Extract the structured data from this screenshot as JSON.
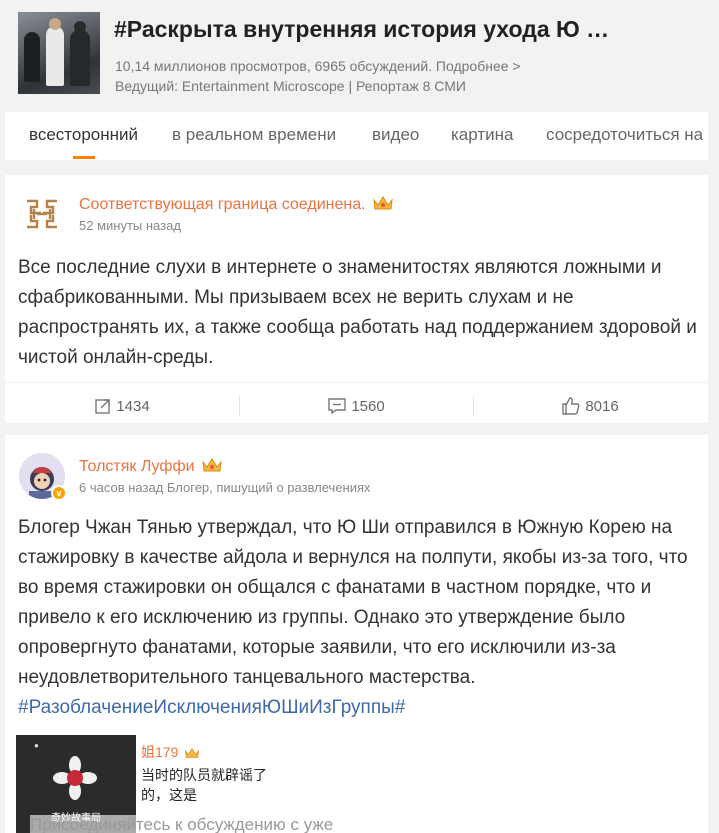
{
  "topic": {
    "title": "#Раскрыта внутренняя история ухода Ю …",
    "meta": "10,14 миллионов просмотров, 6965 обсуждений. Подробнее >",
    "host": "Ведущий: Entertainment Microscope | Репортаж 8 СМИ"
  },
  "tabs": [
    {
      "label": "всесторонний",
      "active": true
    },
    {
      "label": "в реальном времени"
    },
    {
      "label": "видео"
    },
    {
      "label": "картина"
    },
    {
      "label": "сосредоточиться на"
    }
  ],
  "colors": {
    "accent": "#ff8200",
    "username": "#eb7340",
    "hashtag": "#3d6aa8"
  },
  "posts": [
    {
      "username": "Соответствующая граница соединена.",
      "time": "52 минуты назад",
      "text": "Все последние слухи в интернете о знаменитостях являются ложными и сфабрикованными. Мы призываем всех не верить слухам и не распространять их, а также сообща работать над поддержанием здоровой и чистой онлайн-среды.",
      "reposts": "1434",
      "comments": "1560",
      "likes": "8016"
    },
    {
      "username": "Толстяк Луффи",
      "time": "6 часов назад Блогер, пишущий о развлечениях",
      "text": "Блогер Чжан Тянью утверждал, что Ю Ши отправился в Южную Корею на стажировку в качестве айдола и вернулся на полпути, якобы из-за того, что во время стажировки он общался с фанатами в частном порядке, что и привело к его исключению из группы. Однако это утверждение было опровергнуто фанатами, которые заявили, что его исключили из-за неудовлетворительного танцевального мастерства.",
      "hashtag": "#РазоблачениеИсключенияЮШиИзГруппы#"
    }
  ],
  "preview": {
    "name": "姐179",
    "line1": "当时的队员就辟谣了",
    "line2": "的，这是",
    "image_caption": "奇妙故事局",
    "join_text": "Присоединяйтесь к обсуждению с уже"
  }
}
